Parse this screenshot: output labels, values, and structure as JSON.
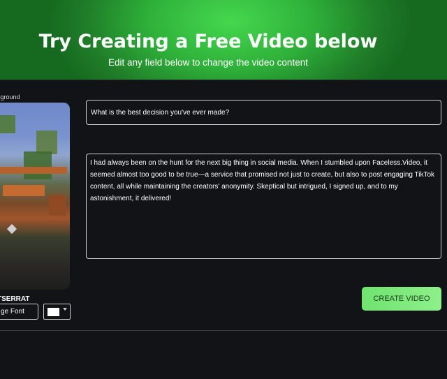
{
  "hero": {
    "title": "Try Creating a Free Video below",
    "subtitle": "Edit any field below to change the video content"
  },
  "editor": {
    "background_label": "kground",
    "font_name": "TSERRAT",
    "change_font_label": "ge Font",
    "text_color": "#ffffff",
    "question_value": "What is the best decision you've ever made?",
    "story_value": "I had always been on the hunt for the next big thing in social media. When I stumbled upon Faceless.Video, it seemed almost too good to be true—a service that promised not just to create, but also to post engaging TikTok content, all while maintaining the creators' anonymity. Skeptical but intrigued, I signed up, and to my astonishment, it delivered!",
    "create_button_label": "CREATE VIDEO"
  },
  "colors": {
    "accent": "#45d84e",
    "button": "#8ef08a",
    "background": "#121316"
  }
}
